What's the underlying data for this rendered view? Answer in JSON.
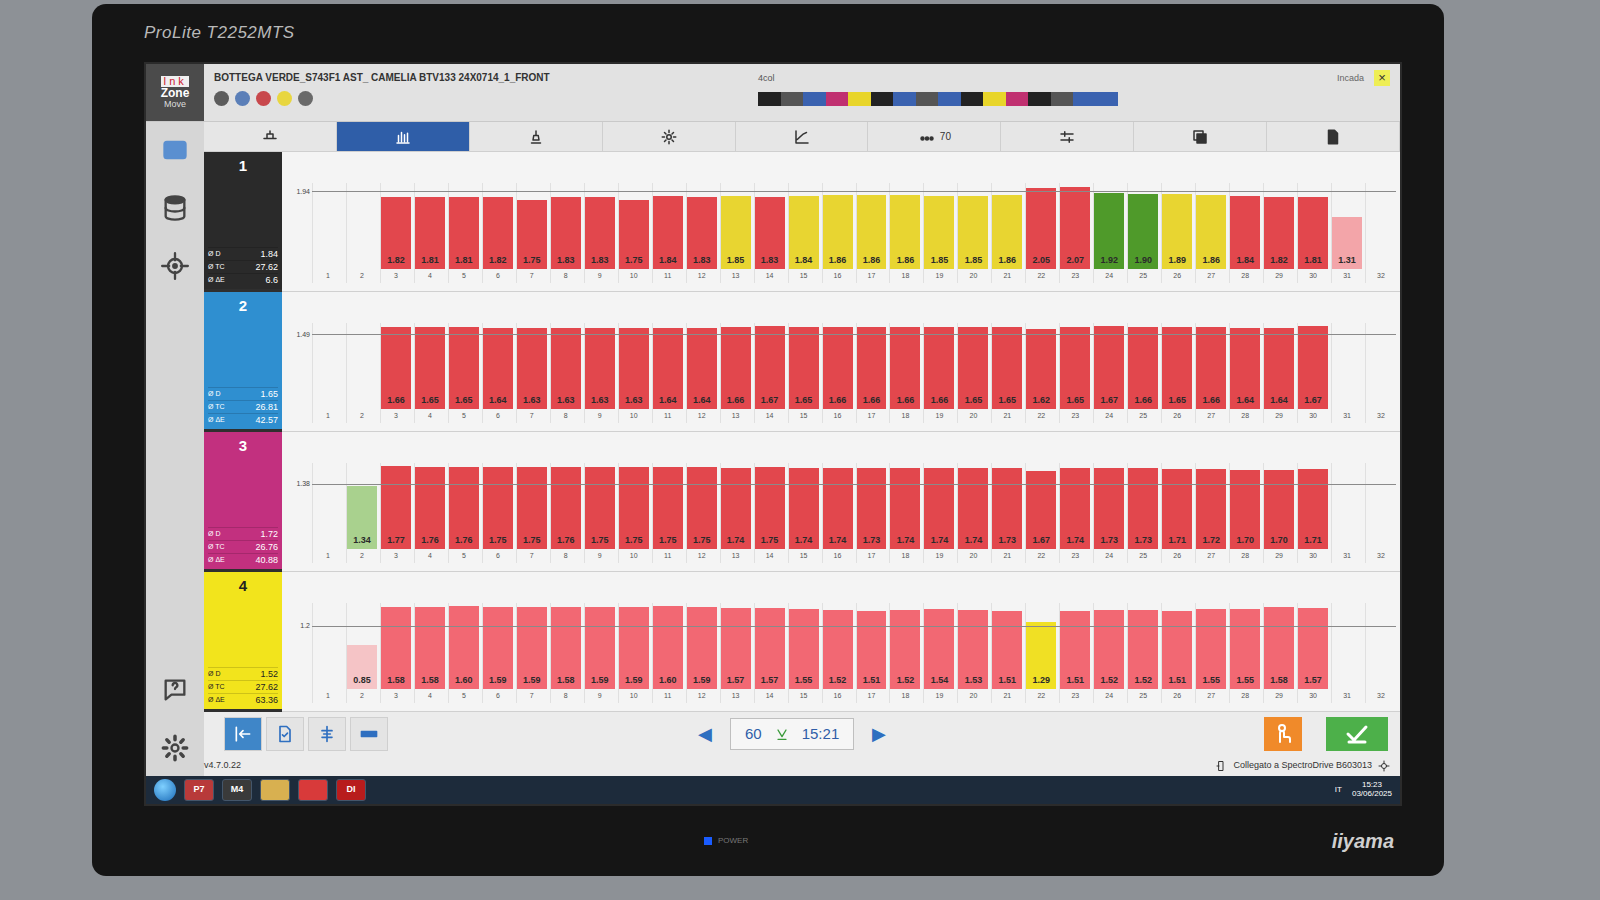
{
  "monitor": {
    "model": "ProLite T2252MTS",
    "brand": "iiyama",
    "power_label": "POWER"
  },
  "app": {
    "logo": {
      "line1": "Ink",
      "line2": "Zone",
      "line3": "Move"
    },
    "job_title": "BOTTEGA VERDE_S743F1 AST_ CAMELIA BTV133 24X0714_1_FRONT",
    "ink_dots": [
      {
        "color": "#5c5c5c"
      },
      {
        "color": "#5b7fb8"
      },
      {
        "color": "#c8484c"
      },
      {
        "color": "#e8d640"
      },
      {
        "color": "#6a6a6a"
      }
    ],
    "color_bar": {
      "label": "4col",
      "segments": [
        "#222222",
        "#555555",
        "#3a62b0",
        "#c03070",
        "#e8d52a",
        "#222222",
        "#3a62b0",
        "#555555",
        "#3a62b0",
        "#222222",
        "#e8d52a",
        "#c03070",
        "#222222",
        "#555555",
        "#3a62b0",
        "#3a62b0"
      ]
    },
    "user": "Incada",
    "close": "×",
    "tabs": [
      {
        "selected": false
      },
      {
        "selected": true
      },
      {
        "selected": false
      },
      {
        "selected": false
      },
      {
        "selected": false
      },
      {
        "selected": false,
        "text": "70"
      },
      {
        "selected": false
      },
      {
        "selected": false
      },
      {
        "selected": false
      }
    ],
    "zone_labels": [
      "1",
      "2",
      "3",
      "4",
      "5",
      "6",
      "7",
      "8",
      "9",
      "10",
      "11",
      "12",
      "13",
      "14",
      "15",
      "16",
      "17",
      "18",
      "19",
      "20",
      "21",
      "22",
      "23",
      "24",
      "25",
      "26",
      "27",
      "28",
      "29",
      "30",
      "31",
      "32"
    ],
    "units": [
      {
        "number": "1",
        "color": "#2a2a2a",
        "target": "1.94",
        "target_value": 1.94,
        "stats": [
          {
            "label": "Ø D",
            "value": "1.84"
          },
          {
            "label": "Ø TC",
            "value": "27.62"
          },
          {
            "label": "Ø ΔE",
            "value": "6.6"
          }
        ],
        "bars": [
          null,
          null,
          {
            "label": "1.82",
            "value": 1.82,
            "color": "#e2474d"
          },
          {
            "label": "1.81",
            "value": 1.81,
            "color": "#e2474d"
          },
          {
            "label": "1.81",
            "value": 1.81,
            "color": "#e2474d"
          },
          {
            "label": "1.82",
            "value": 1.82,
            "color": "#e2474d"
          },
          {
            "label": "1.75",
            "value": 1.75,
            "color": "#e2474d"
          },
          {
            "label": "1.83",
            "value": 1.83,
            "color": "#e2474d"
          },
          {
            "label": "1.83",
            "value": 1.83,
            "color": "#e2474d"
          },
          {
            "label": "1.75",
            "value": 1.75,
            "color": "#e2474d"
          },
          {
            "label": "1.84",
            "value": 1.84,
            "color": "#e2474d"
          },
          {
            "label": "1.83",
            "value": 1.83,
            "color": "#e2474d"
          },
          {
            "label": "1.85",
            "value": 1.85,
            "color": "#e8d531"
          },
          {
            "label": "1.83",
            "value": 1.83,
            "color": "#e2474d"
          },
          {
            "label": "1.84",
            "value": 1.84,
            "color": "#e8d531"
          },
          {
            "label": "1.86",
            "value": 1.86,
            "color": "#e8d531"
          },
          {
            "label": "1.86",
            "value": 1.86,
            "color": "#e8d531"
          },
          {
            "label": "1.86",
            "value": 1.86,
            "color": "#e8d531"
          },
          {
            "label": "1.85",
            "value": 1.85,
            "color": "#e8d531"
          },
          {
            "label": "1.85",
            "value": 1.85,
            "color": "#e8d531"
          },
          {
            "label": "1.86",
            "value": 1.86,
            "color": "#e8d531"
          },
          {
            "label": "2.05",
            "value": 2.05,
            "color": "#e2474d"
          },
          {
            "label": "2.07",
            "value": 2.07,
            "color": "#e2474d"
          },
          {
            "label": "1.92",
            "value": 1.92,
            "color": "#4f9a2a"
          },
          {
            "label": "1.90",
            "value": 1.9,
            "color": "#4f9a2a"
          },
          {
            "label": "1.89",
            "value": 1.89,
            "color": "#e8d531"
          },
          {
            "label": "1.86",
            "value": 1.86,
            "color": "#e8d531"
          },
          {
            "label": "1.84",
            "value": 1.84,
            "color": "#e2474d"
          },
          {
            "label": "1.82",
            "value": 1.82,
            "color": "#e2474d"
          },
          {
            "label": "1.81",
            "value": 1.81,
            "color": "#e2474d"
          },
          {
            "label": "1.31",
            "value": 1.31,
            "color": "#f3a5a9"
          },
          null
        ]
      },
      {
        "number": "2",
        "color": "#2f8fd0",
        "target": "1.49",
        "target_value": 1.49,
        "stats": [
          {
            "label": "Ø D",
            "value": "1.65"
          },
          {
            "label": "Ø TC",
            "value": "26.81"
          },
          {
            "label": "Ø ΔE",
            "value": "42.57"
          }
        ],
        "bars": [
          null,
          null,
          {
            "label": "1.66",
            "value": 1.66,
            "color": "#e2474d"
          },
          {
            "label": "1.65",
            "value": 1.65,
            "color": "#e2474d"
          },
          {
            "label": "1.65",
            "value": 1.65,
            "color": "#e2474d"
          },
          {
            "label": "1.64",
            "value": 1.64,
            "color": "#e2474d"
          },
          {
            "label": "1.63",
            "value": 1.63,
            "color": "#e2474d"
          },
          {
            "label": "1.63",
            "value": 1.63,
            "color": "#e2474d"
          },
          {
            "label": "1.63",
            "value": 1.63,
            "color": "#e2474d"
          },
          {
            "label": "1.63",
            "value": 1.63,
            "color": "#e2474d"
          },
          {
            "label": "1.64",
            "value": 1.64,
            "color": "#e2474d"
          },
          {
            "label": "1.64",
            "value": 1.64,
            "color": "#e2474d"
          },
          {
            "label": "1.66",
            "value": 1.66,
            "color": "#e2474d"
          },
          {
            "label": "1.67",
            "value": 1.67,
            "color": "#e2474d"
          },
          {
            "label": "1.65",
            "value": 1.65,
            "color": "#e2474d"
          },
          {
            "label": "1.66",
            "value": 1.66,
            "color": "#e2474d"
          },
          {
            "label": "1.66",
            "value": 1.66,
            "color": "#e2474d"
          },
          {
            "label": "1.66",
            "value": 1.66,
            "color": "#e2474d"
          },
          {
            "label": "1.66",
            "value": 1.66,
            "color": "#e2474d"
          },
          {
            "label": "1.65",
            "value": 1.65,
            "color": "#e2474d"
          },
          {
            "label": "1.65",
            "value": 1.65,
            "color": "#e2474d"
          },
          {
            "label": "1.62",
            "value": 1.62,
            "color": "#e2474d"
          },
          {
            "label": "1.65",
            "value": 1.65,
            "color": "#e2474d"
          },
          {
            "label": "1.67",
            "value": 1.67,
            "color": "#e2474d"
          },
          {
            "label": "1.66",
            "value": 1.66,
            "color": "#e2474d"
          },
          {
            "label": "1.65",
            "value": 1.65,
            "color": "#e2474d"
          },
          {
            "label": "1.66",
            "value": 1.66,
            "color": "#e2474d"
          },
          {
            "label": "1.64",
            "value": 1.64,
            "color": "#e2474d"
          },
          {
            "label": "1.64",
            "value": 1.64,
            "color": "#e2474d"
          },
          {
            "label": "1.67",
            "value": 1.67,
            "color": "#e2474d"
          },
          null,
          null
        ]
      },
      {
        "number": "3",
        "color": "#c2307f",
        "target": "1.38",
        "target_value": 1.38,
        "stats": [
          {
            "label": "Ø D",
            "value": "1.72"
          },
          {
            "label": "Ø TC",
            "value": "26.76"
          },
          {
            "label": "Ø ΔE",
            "value": "40.88"
          }
        ],
        "bars": [
          null,
          {
            "label": "1.34",
            "value": 1.34,
            "color": "#a9d18e"
          },
          {
            "label": "1.77",
            "value": 1.77,
            "color": "#e2474d"
          },
          {
            "label": "1.76",
            "value": 1.76,
            "color": "#e2474d"
          },
          {
            "label": "1.76",
            "value": 1.76,
            "color": "#e2474d"
          },
          {
            "label": "1.75",
            "value": 1.75,
            "color": "#e2474d"
          },
          {
            "label": "1.75",
            "value": 1.75,
            "color": "#e2474d"
          },
          {
            "label": "1.76",
            "value": 1.76,
            "color": "#e2474d"
          },
          {
            "label": "1.75",
            "value": 1.75,
            "color": "#e2474d"
          },
          {
            "label": "1.75",
            "value": 1.75,
            "color": "#e2474d"
          },
          {
            "label": "1.75",
            "value": 1.75,
            "color": "#e2474d"
          },
          {
            "label": "1.75",
            "value": 1.75,
            "color": "#e2474d"
          },
          {
            "label": "1.74",
            "value": 1.74,
            "color": "#e2474d"
          },
          {
            "label": "1.75",
            "value": 1.75,
            "color": "#e2474d"
          },
          {
            "label": "1.74",
            "value": 1.74,
            "color": "#e2474d"
          },
          {
            "label": "1.74",
            "value": 1.74,
            "color": "#e2474d"
          },
          {
            "label": "1.73",
            "value": 1.73,
            "color": "#e2474d"
          },
          {
            "label": "1.74",
            "value": 1.74,
            "color": "#e2474d"
          },
          {
            "label": "1.74",
            "value": 1.74,
            "color": "#e2474d"
          },
          {
            "label": "1.74",
            "value": 1.74,
            "color": "#e2474d"
          },
          {
            "label": "1.73",
            "value": 1.73,
            "color": "#e2474d"
          },
          {
            "label": "1.67",
            "value": 1.67,
            "color": "#e2474d"
          },
          {
            "label": "1.74",
            "value": 1.74,
            "color": "#e2474d"
          },
          {
            "label": "1.73",
            "value": 1.73,
            "color": "#e2474d"
          },
          {
            "label": "1.73",
            "value": 1.73,
            "color": "#e2474d"
          },
          {
            "label": "1.71",
            "value": 1.71,
            "color": "#e2474d"
          },
          {
            "label": "1.72",
            "value": 1.72,
            "color": "#e2474d"
          },
          {
            "label": "1.70",
            "value": 1.7,
            "color": "#e2474d"
          },
          {
            "label": "1.70",
            "value": 1.7,
            "color": "#e2474d"
          },
          {
            "label": "1.71",
            "value": 1.71,
            "color": "#e2474d"
          },
          null,
          null
        ]
      },
      {
        "number": "4",
        "color": "#f2e41c",
        "target": "1.2",
        "target_value": 1.2,
        "stats": [
          {
            "label": "Ø D",
            "value": "1.52"
          },
          {
            "label": "Ø TC",
            "value": "27.62"
          },
          {
            "label": "Ø ΔE",
            "value": "63.36"
          }
        ],
        "bars": [
          null,
          {
            "label": "0.85",
            "value": 0.85,
            "color": "#f5c4c6"
          },
          {
            "label": "1.58",
            "value": 1.58,
            "color": "#f26873"
          },
          {
            "label": "1.58",
            "value": 1.58,
            "color": "#f26873"
          },
          {
            "label": "1.60",
            "value": 1.6,
            "color": "#f26873"
          },
          {
            "label": "1.59",
            "value": 1.59,
            "color": "#f26873"
          },
          {
            "label": "1.59",
            "value": 1.59,
            "color": "#f26873"
          },
          {
            "label": "1.58",
            "value": 1.58,
            "color": "#f26873"
          },
          {
            "label": "1.59",
            "value": 1.59,
            "color": "#f26873"
          },
          {
            "label": "1.59",
            "value": 1.59,
            "color": "#f26873"
          },
          {
            "label": "1.60",
            "value": 1.6,
            "color": "#f26873"
          },
          {
            "label": "1.59",
            "value": 1.59,
            "color": "#f26873"
          },
          {
            "label": "1.57",
            "value": 1.57,
            "color": "#f26873"
          },
          {
            "label": "1.57",
            "value": 1.57,
            "color": "#f26873"
          },
          {
            "label": "1.55",
            "value": 1.55,
            "color": "#f26873"
          },
          {
            "label": "1.52",
            "value": 1.52,
            "color": "#f26873"
          },
          {
            "label": "1.51",
            "value": 1.51,
            "color": "#f26873"
          },
          {
            "label": "1.52",
            "value": 1.52,
            "color": "#f26873"
          },
          {
            "label": "1.54",
            "value": 1.54,
            "color": "#f26873"
          },
          {
            "label": "1.53",
            "value": 1.53,
            "color": "#f26873"
          },
          {
            "label": "1.51",
            "value": 1.51,
            "color": "#f26873"
          },
          {
            "label": "1.29",
            "value": 1.29,
            "color": "#f0e024"
          },
          {
            "label": "1.51",
            "value": 1.51,
            "color": "#f26873"
          },
          {
            "label": "1.52",
            "value": 1.52,
            "color": "#f26873"
          },
          {
            "label": "1.52",
            "value": 1.52,
            "color": "#f26873"
          },
          {
            "label": "1.51",
            "value": 1.51,
            "color": "#f26873"
          },
          {
            "label": "1.55",
            "value": 1.55,
            "color": "#f26873"
          },
          {
            "label": "1.55",
            "value": 1.55,
            "color": "#f26873"
          },
          {
            "label": "1.58",
            "value": 1.58,
            "color": "#f26873"
          },
          {
            "label": "1.57",
            "value": 1.57,
            "color": "#f26873"
          },
          null,
          null
        ]
      }
    ],
    "toolbar": {
      "tools": [
        {
          "selected": true
        },
        {
          "selected": false
        },
        {
          "selected": false
        },
        {
          "selected": false
        }
      ],
      "prev": "◀",
      "page": "60",
      "time": "15:21",
      "next": "▶"
    },
    "version": "v4.7.0.22",
    "connection": "Collegato a SpectroDrive B603013"
  },
  "taskbar": {
    "apps": [
      {
        "label": "P7",
        "color": "#b83a3a"
      },
      {
        "label": "M4",
        "color": "#3a3a3a"
      },
      {
        "label": "",
        "color": "#d8b050"
      },
      {
        "label": "",
        "color": "#d83a3a"
      },
      {
        "label": "DI",
        "color": "#b81c1c"
      }
    ],
    "language": "IT",
    "time": "15:23",
    "date": "03/06/2025"
  }
}
